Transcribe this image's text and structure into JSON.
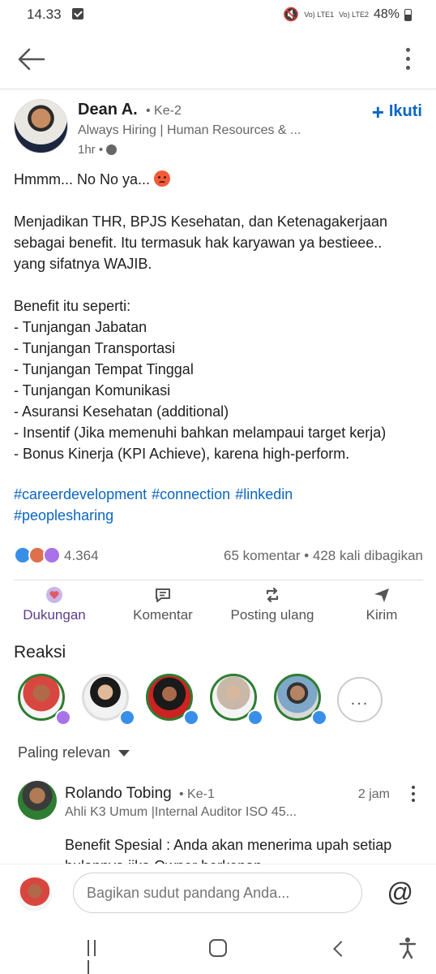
{
  "status_bar": {
    "time": "14.33",
    "signal_1": "Vo) LTE1",
    "signal_2": "Vo) LTE2",
    "battery": "48%"
  },
  "author": {
    "name": "Dean A.",
    "degree": "• Ke-2",
    "headline": "Always Hiring | Human Resources & ...",
    "time": "1hr •",
    "follow_label": "Ikuti"
  },
  "post": {
    "lines": [
      "Hmmm... No No ya...",
      "",
      "Menjadikan THR, BPJS Kesehatan, dan Ketenagakerjaan",
      "sebagai benefit. Itu termasuk hak karyawan ya bestieee..",
      "yang sifatnya WAJIB.",
      "",
      "Benefit itu seperti:",
      "- Tunjangan Jabatan",
      "- Tunjangan Transportasi",
      "- Tunjangan Tempat Tinggal",
      "- Tunjangan Komunikasi",
      "- Asuransi Kesehatan (additional)",
      "- Insentif (Jika memenuhi bahkan melampaui target kerja)",
      "- Bonus Kinerja (KPI Achieve), karena high-perform."
    ],
    "hashtags": [
      "#careerdevelopment",
      "#connection",
      "#linkedin",
      "#peoplesharing"
    ]
  },
  "social": {
    "reaction_count": "4.364",
    "comments_shares": "65 komentar • 428 kali dibagikan"
  },
  "actions": [
    {
      "label": "Dukungan",
      "icon": "support-heart-icon"
    },
    {
      "label": "Komentar",
      "icon": "comment-icon"
    },
    {
      "label": "Posting ulang",
      "icon": "repost-icon"
    },
    {
      "label": "Kirim",
      "icon": "send-icon"
    }
  ],
  "reactions_section": {
    "title": "Reaksi",
    "more_label": "..."
  },
  "sort": {
    "label": "Paling relevan"
  },
  "comment": {
    "name": "Rolando Tobing",
    "degree": "• Ke-1",
    "time": "2 jam",
    "headline": "Ahli K3 Umum |Internal Auditor ISO 45...",
    "text": "Benefit Spesial : Anda akan menerima upah setiap bulannya jika Owner berkenan..."
  },
  "compose": {
    "placeholder": "Bagikan sudut pandang Anda...",
    "mention_symbol": "@"
  },
  "colors": {
    "accent": "#0a66c2",
    "support_active": "#5c3d8a",
    "open_to_work_ring": "#2e7d32"
  }
}
